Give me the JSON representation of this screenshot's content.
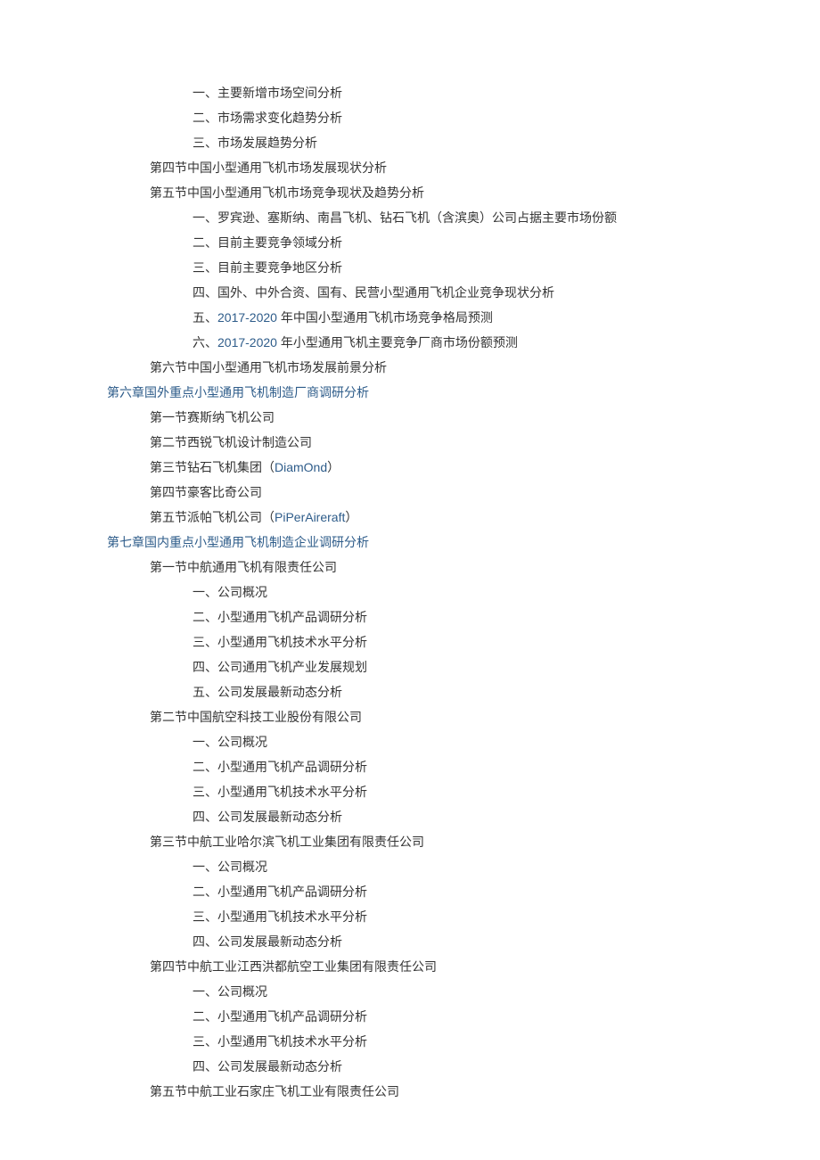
{
  "lines": [
    {
      "level": 3,
      "text": "一、主要新增市场空间分析",
      "blue": false
    },
    {
      "level": 3,
      "text": "二、市场需求变化趋势分析",
      "blue": false
    },
    {
      "level": 3,
      "text": "三、市场发展趋势分析",
      "blue": false
    },
    {
      "level": 2,
      "text": "第四节中国小型通用飞机市场发展现状分析",
      "blue": false
    },
    {
      "level": 2,
      "text": "第五节中国小型通用飞机市场竞争现状及趋势分析",
      "blue": false
    },
    {
      "level": 3,
      "text": "一、罗宾逊、塞斯纳、南昌飞机、钻石飞机（含滨奥）公司占据主要市场份额",
      "blue": false
    },
    {
      "level": 3,
      "text": "二、目前主要竞争领域分析",
      "blue": false
    },
    {
      "level": 3,
      "text": "三、目前主要竞争地区分析",
      "blue": false
    },
    {
      "level": 3,
      "text": "四、国外、中外合资、国有、民营小型通用飞机企业竞争现状分析",
      "blue": false
    },
    {
      "level": 3,
      "parts": [
        {
          "t": "五、",
          "b": false
        },
        {
          "t": "2017-2020",
          "b": true
        },
        {
          "t": " 年中国小型通用飞机市场竞争格局预测",
          "b": false
        }
      ]
    },
    {
      "level": 3,
      "parts": [
        {
          "t": "六、",
          "b": false
        },
        {
          "t": "2017-2020",
          "b": true
        },
        {
          "t": " 年小型通用飞机主要竞争厂商市场份额预测",
          "b": false
        }
      ]
    },
    {
      "level": 2,
      "text": "第六节中国小型通用飞机市场发展前景分析",
      "blue": false
    },
    {
      "level": 1,
      "text": "第六章国外重点小型通用飞机制造厂商调研分析",
      "blue": true
    },
    {
      "level": 2,
      "text": "第一节赛斯纳飞机公司",
      "blue": false
    },
    {
      "level": 2,
      "parts": [
        {
          "t": "第二节",
          "b": false
        },
        {
          "t": "西",
          "b": false,
          "dark": true
        },
        {
          "t": "锐飞机设计制造公司",
          "b": false
        }
      ]
    },
    {
      "level": 2,
      "parts": [
        {
          "t": "第三节钻石飞机集团（",
          "b": false
        },
        {
          "t": "DiamOnd",
          "b": true
        },
        {
          "t": "）",
          "b": false
        }
      ]
    },
    {
      "level": 2,
      "text": "第四节豪客比奇公司",
      "blue": false
    },
    {
      "level": 2,
      "parts": [
        {
          "t": "第五节派帕飞机公司（",
          "b": false
        },
        {
          "t": "PiPerAireraft",
          "b": true
        },
        {
          "t": "）",
          "b": false
        }
      ]
    },
    {
      "level": 1,
      "text": "第七章国内重点小型通用飞机制造企业调研分析",
      "blue": true
    },
    {
      "level": 2,
      "text": "第一节中航通用飞机有限责任公司",
      "blue": false
    },
    {
      "level": 3,
      "text": "一、公司概况",
      "blue": false
    },
    {
      "level": 3,
      "text": "二、小型通用飞机产品调研分析",
      "blue": false
    },
    {
      "level": 3,
      "text": "三、小型通用飞机技术水平分析",
      "blue": false
    },
    {
      "level": 3,
      "text": "四、公司通用飞机产业发展规划",
      "blue": false
    },
    {
      "level": 3,
      "text": "五、公司发展最新动态分析",
      "blue": false
    },
    {
      "level": 2,
      "text": "第二节中国航空科技工业股份有限公司",
      "blue": false
    },
    {
      "level": 3,
      "text": "一、公司概况",
      "blue": false
    },
    {
      "level": 3,
      "text": "二、小型通用飞机产品调研分析",
      "blue": false
    },
    {
      "level": 3,
      "text": "三、小型通用飞机技术水平分析",
      "blue": false
    },
    {
      "level": 3,
      "text": "四、公司发展最新动态分析",
      "blue": false
    },
    {
      "level": 2,
      "text": "第三节中航工业哈尔滨飞机工业集团有限责任公司",
      "blue": false
    },
    {
      "level": 3,
      "text": "一、公司概况",
      "blue": false
    },
    {
      "level": 3,
      "text": "二、小型通用飞机产品调研分析",
      "blue": false
    },
    {
      "level": 3,
      "text": "三、小型通用飞机技术水平分析",
      "blue": false
    },
    {
      "level": 3,
      "text": "四、公司发展最新动态分析",
      "blue": false
    },
    {
      "level": 2,
      "text": "第四节中航工业江西洪都航空工业集团有限责任公司",
      "blue": false
    },
    {
      "level": 3,
      "text": "一、公司概况",
      "blue": false
    },
    {
      "level": 3,
      "text": "二、小型通用飞机产品调研分析",
      "blue": false
    },
    {
      "level": 3,
      "text": "三、小型通用飞机技术水平分析",
      "blue": false
    },
    {
      "level": 3,
      "text": "四、公司发展最新动态分析",
      "blue": false
    },
    {
      "level": 2,
      "text": "第五节中航工业石家庄飞机工业有限责任公司",
      "blue": false
    }
  ]
}
